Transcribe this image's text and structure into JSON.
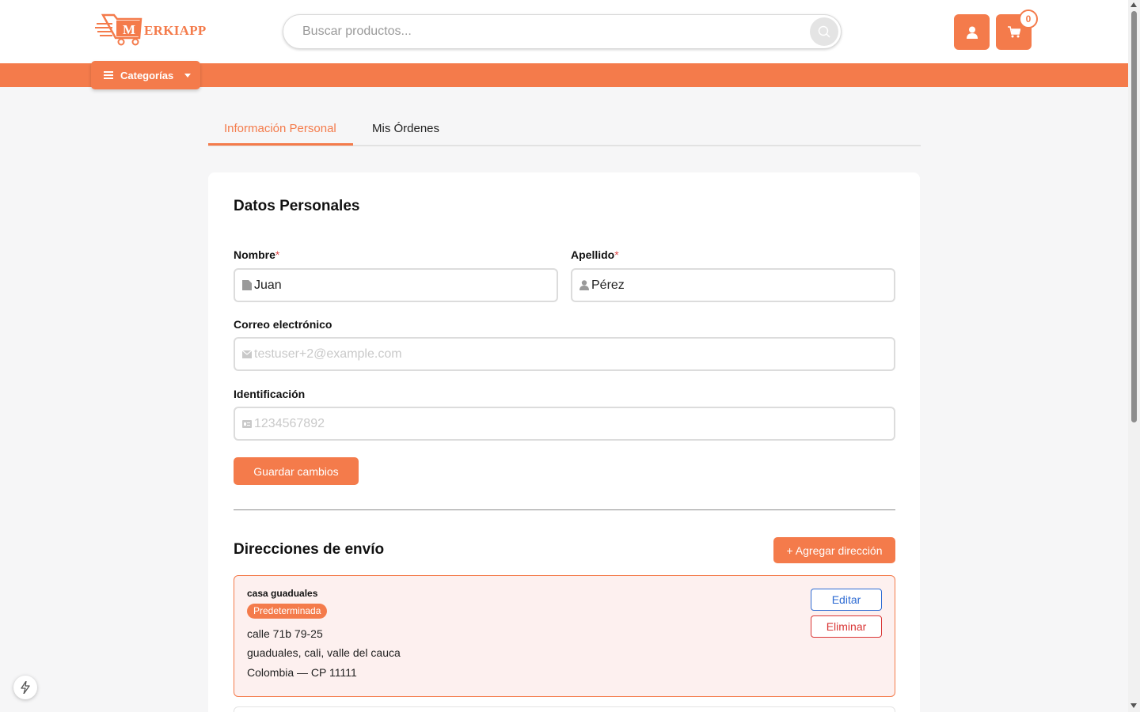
{
  "header": {
    "logo_text": "ERKIAPP",
    "logo_letter": "M",
    "search": {
      "placeholder": "Buscar productos...",
      "value": ""
    },
    "cart_count": "0",
    "categories_label": "Categorías"
  },
  "tabs": [
    {
      "label": "Información Personal",
      "active": true
    },
    {
      "label": "Mis Órdenes",
      "active": false
    }
  ],
  "personal": {
    "title": "Datos Personales",
    "first_name": {
      "label": "Nombre",
      "required": "*",
      "value": "Juan"
    },
    "last_name": {
      "label": "Apellido",
      "required": "*",
      "value": "Pérez"
    },
    "email": {
      "label": "Correo electrónico",
      "value": "testuser+2@example.com"
    },
    "id_number": {
      "label": "Identificación",
      "value": "1234567892"
    },
    "save_label": "Guardar cambios"
  },
  "shipping": {
    "title": "Direcciones de envío",
    "add_label": "+ Agregar dirección",
    "addresses": [
      {
        "name": "casa guaduales",
        "badge": "Predeterminada",
        "line1": "calle 71b 79-25",
        "line2": "guaduales, cali, valle del cauca",
        "line3": "Colombia — CP 11111",
        "edit_label": "Editar",
        "delete_label": "Eliminar"
      }
    ]
  },
  "colors": {
    "accent": "#f47b4b",
    "edit": "#2e6bd3",
    "delete": "#d93636",
    "address_bg": "#fdf0ef"
  },
  "icons": [
    "cart-logo-icon",
    "search-icon",
    "user-icon",
    "cart-icon",
    "menu-icon",
    "id-card-icon",
    "user-icon",
    "envelope-icon",
    "id-badge-icon",
    "bolt-icon"
  ]
}
